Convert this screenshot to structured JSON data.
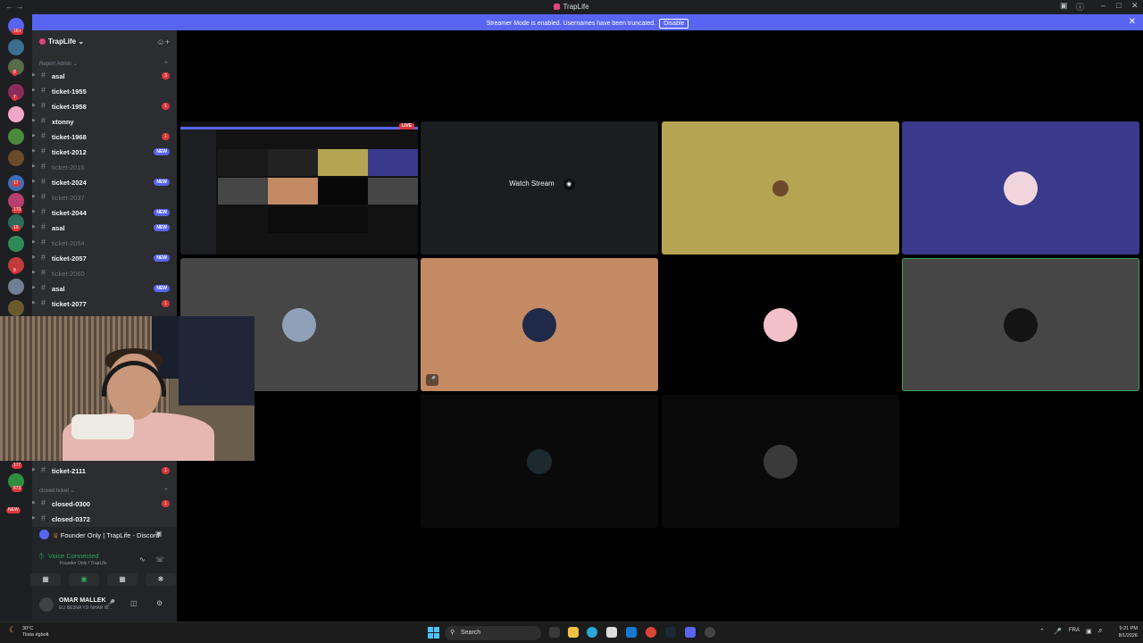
{
  "window": {
    "title": "TrapLife"
  },
  "banner": {
    "text": "Streamer Mode is enabled. Usernames have been truncated.",
    "disable_label": "Disable"
  },
  "guild_badges": [
    "1K+",
    "8",
    "7",
    "17",
    "170",
    "19",
    "9",
    "177",
    "673",
    "NEW"
  ],
  "sidebar": {
    "server_name": "TrapLife",
    "categories": [
      {
        "label": "Report Admin"
      },
      {
        "label": "closed ticket"
      }
    ],
    "channels": [
      {
        "name": "asal",
        "badge": "3",
        "muted": false
      },
      {
        "name": "ticket-1955",
        "badge": "",
        "muted": false
      },
      {
        "name": "ticket-1958",
        "badge": "1",
        "muted": false
      },
      {
        "name": "xtonny",
        "badge": "",
        "muted": false
      },
      {
        "name": "ticket-1968",
        "badge": "1",
        "muted": false
      },
      {
        "name": "ticket-2012",
        "badge": "NEW",
        "muted": false
      },
      {
        "name": "ticket-2016",
        "badge": "",
        "muted": true
      },
      {
        "name": "ticket-2024",
        "badge": "NEW",
        "muted": false
      },
      {
        "name": "ticket-2037",
        "badge": "",
        "muted": true
      },
      {
        "name": "ticket-2044",
        "badge": "NEW",
        "muted": false
      },
      {
        "name": "asal",
        "badge": "NEW",
        "muted": false
      },
      {
        "name": "ticket-2054",
        "badge": "",
        "muted": true
      },
      {
        "name": "ticket-2057",
        "badge": "NEW",
        "muted": false
      },
      {
        "name": "ticket-2060",
        "badge": "",
        "muted": true
      },
      {
        "name": "asal",
        "badge": "NEW",
        "muted": false
      },
      {
        "name": "ticket-2077",
        "badge": "1",
        "muted": false
      }
    ],
    "lower_channels": [
      {
        "name": "ticket-2111",
        "badge": "1",
        "muted": false
      }
    ],
    "closed_channels": [
      {
        "name": "closed-0300",
        "badge": "1",
        "muted": false
      },
      {
        "name": "closed-0372",
        "badge": "",
        "muted": false
      }
    ]
  },
  "voice_panel": {
    "title": "Founder Only | TrapLife - Discord",
    "status": "Voice Connected",
    "channel": "Founder Only / TrapLife"
  },
  "user": {
    "name": "OMAR MALLEK",
    "status": "ELI BE3NA Y3I NHAR W..."
  },
  "stage": {
    "live_label": "LIVE",
    "watch_label": "Watch Stream"
  },
  "taskbar": {
    "temp": "30°C",
    "weather": "Tiista égbolt",
    "search_placeholder": "Search",
    "lang": "FRA",
    "time": "9:21 PM",
    "date": "8/1/2026"
  },
  "colors": {
    "blurple": "#5865f2",
    "tile_gold": "#b5a553",
    "tile_indigo": "#3a3a8c",
    "tile_tan": "#c48a64",
    "tile_gray": "#464646",
    "speaking_green": "#3ba55d"
  }
}
